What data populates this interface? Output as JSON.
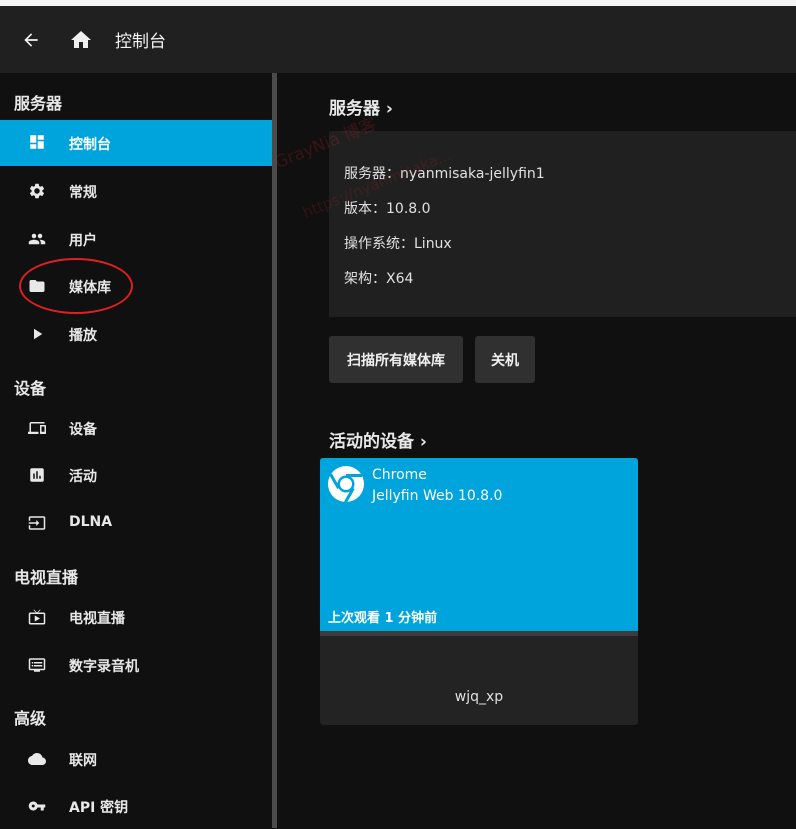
{
  "header": {
    "title": "控制台",
    "back_icon": "arrow-back-icon",
    "home_icon": "home-icon"
  },
  "sidebar": {
    "sections": [
      {
        "title": "服务器",
        "items": [
          {
            "label": "控制台",
            "icon": "dashboard-icon",
            "active": true
          },
          {
            "label": "常规",
            "icon": "settings-icon"
          },
          {
            "label": "用户",
            "icon": "people-icon"
          },
          {
            "label": "媒体库",
            "icon": "folder-icon"
          },
          {
            "label": "播放",
            "icon": "play-icon"
          }
        ]
      },
      {
        "title": "设备",
        "items": [
          {
            "label": "设备",
            "icon": "devices-icon"
          },
          {
            "label": "活动",
            "icon": "assessment-icon"
          },
          {
            "label": "DLNA",
            "icon": "input-icon"
          }
        ]
      },
      {
        "title": "电视直播",
        "items": [
          {
            "label": "电视直播",
            "icon": "live-tv-icon"
          },
          {
            "label": "数字录音机",
            "icon": "dvr-icon"
          }
        ]
      },
      {
        "title": "高级",
        "items": [
          {
            "label": "联网",
            "icon": "cloud-icon"
          },
          {
            "label": "API 密钥",
            "icon": "vpn-key-icon"
          }
        ]
      }
    ]
  },
  "server": {
    "section_title": "服务器 ›",
    "lines": [
      "服务器：nyanmisaka-jellyfin1",
      "版本：10.8.0",
      "操作系统：Linux",
      "架构：X64"
    ],
    "scan_button": "扫描所有媒体库",
    "shutdown_button": "关机"
  },
  "devices": {
    "section_title": "活动的设备 ›",
    "card": {
      "client": "Chrome",
      "app": "Jellyfin Web 10.8.0",
      "last_seen": "上次观看 1 分钟前",
      "user": "wjq_xp",
      "icon": "chrome-icon"
    }
  },
  "watermark": {
    "line1": "GrayNia 博客",
    "line2": "https://nyanmisaka..."
  },
  "colors": {
    "accent": "#00a4dc",
    "header_bg": "#202020",
    "page_bg": "#101010",
    "annotation": "#e02020"
  }
}
